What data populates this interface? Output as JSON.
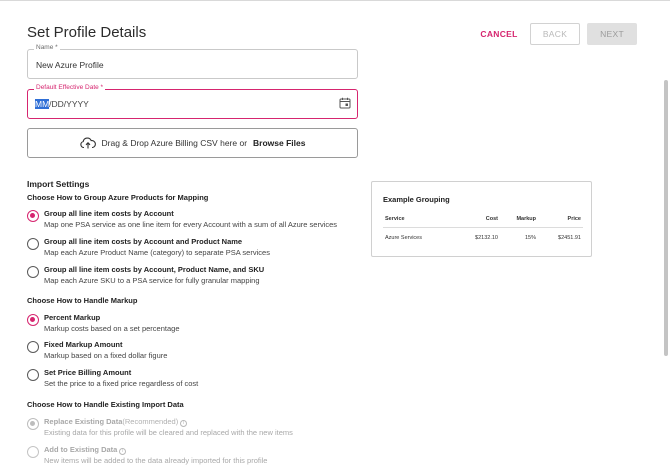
{
  "header": {
    "title": "Set Profile Details",
    "cancel_label": "CANCEL",
    "back_label": "BACK",
    "next_label": "NEXT"
  },
  "name_field": {
    "label": "Name *",
    "value": "New Azure Profile"
  },
  "date_field": {
    "label": "Default Effective Date *",
    "selected_part": "MM",
    "rest": "/DD/YYYY",
    "icon": "calendar-icon"
  },
  "upload": {
    "icon": "cloud-upload-icon",
    "text": "Drag & Drop Azure Billing CSV here or",
    "link": "Browse Files"
  },
  "import_settings": {
    "title": "Import Settings",
    "grouping": {
      "title": "Choose How to Group Azure Products for Mapping",
      "options": [
        {
          "label": "Group all line item costs by Account",
          "desc": "Map one PSA service as one line item for every Account with a sum of all Azure services",
          "selected": true
        },
        {
          "label": "Group all line item costs by Account and Product Name",
          "desc": "Map each Azure Product Name (category) to separate PSA services",
          "selected": false
        },
        {
          "label": "Group all line item costs by Account, Product Name, and SKU",
          "desc": "Map each Azure SKU to a PSA service for fully granular mapping",
          "selected": false
        }
      ]
    },
    "markup": {
      "title": "Choose How to Handle Markup",
      "options": [
        {
          "label": "Percent Markup",
          "desc": "Markup costs based on a set percentage",
          "selected": true
        },
        {
          "label": "Fixed Markup Amount",
          "desc": "Markup based on a fixed dollar figure",
          "selected": false
        },
        {
          "label": "Set Price Billing Amount",
          "desc": "Set the price to a fixed price regardless of cost",
          "selected": false
        }
      ]
    },
    "existing": {
      "title": "Choose How to Handle Existing Import Data",
      "options": [
        {
          "label": "Replace Existing Data",
          "hint": "(Recommended)",
          "desc": "Existing data for this profile will be cleared and replaced with the new items",
          "selected": true
        },
        {
          "label": "Add to Existing Data",
          "hint": "",
          "desc": "New items will be added to the data already imported for this profile",
          "selected": false
        }
      ]
    }
  },
  "example": {
    "title": "Example Grouping",
    "columns": [
      "Service",
      "Cost",
      "Markup",
      "Price"
    ],
    "rows": [
      [
        "Azure Services",
        "$2132.10",
        "15%",
        "$2451.91"
      ]
    ]
  },
  "colors": {
    "accent": "#d6256f",
    "disabled": "#a8a8a8"
  }
}
